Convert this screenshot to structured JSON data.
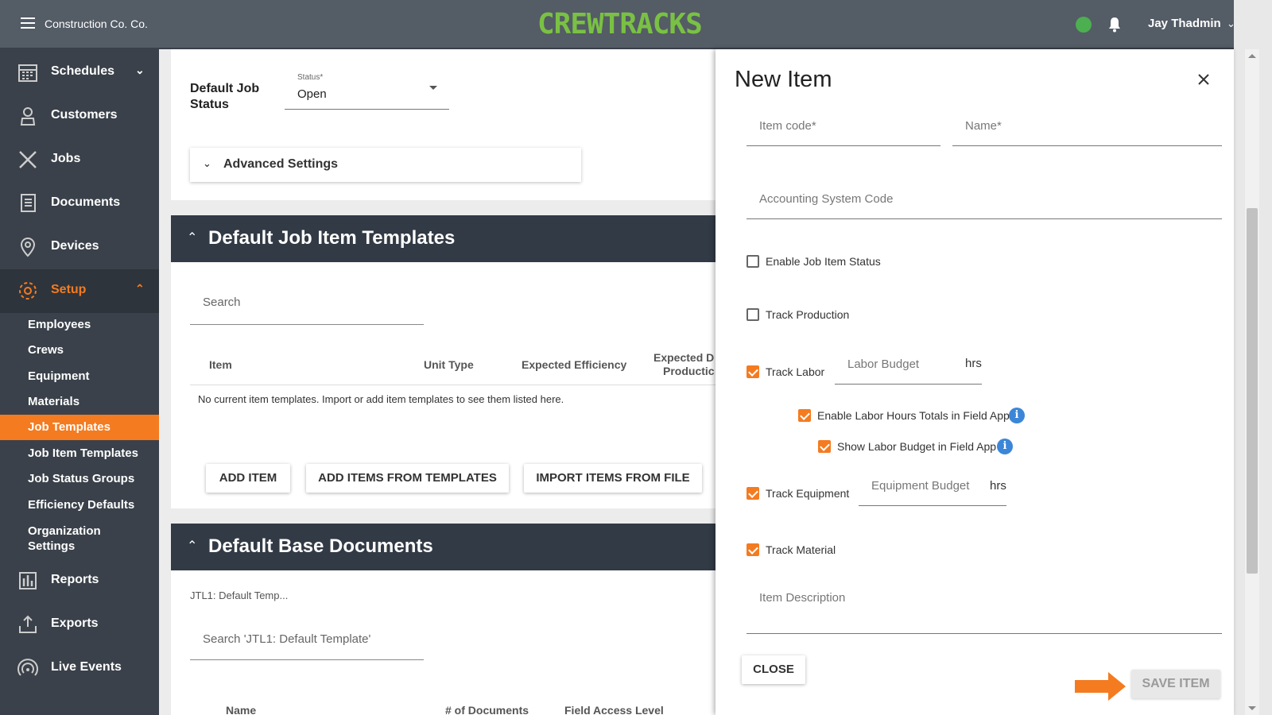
{
  "header": {
    "company": "Construction Co. Co.",
    "logo": "CREWTRACKS",
    "user": "Jay Thadmin",
    "status_color": "#4caf50"
  },
  "sidebar": {
    "items": [
      {
        "label": "Schedules",
        "icon": "calendar-icon"
      },
      {
        "label": "Customers",
        "icon": "customer-icon"
      },
      {
        "label": "Jobs",
        "icon": "tools-icon"
      },
      {
        "label": "Documents",
        "icon": "documents-icon"
      },
      {
        "label": "Devices",
        "icon": "location-pin-icon"
      },
      {
        "label": "Setup",
        "icon": "gear-icon"
      },
      {
        "label": "Reports",
        "icon": "bar-chart-icon"
      },
      {
        "label": "Exports",
        "icon": "export-icon"
      },
      {
        "label": "Live Events",
        "icon": "broadcast-icon"
      }
    ],
    "setup_items": [
      "Employees",
      "Crews",
      "Equipment",
      "Materials",
      "Job Templates",
      "Job Item Templates",
      "Job Status Groups",
      "Efficiency Defaults",
      "Organization Settings"
    ],
    "active_color": "#f47b20"
  },
  "main": {
    "default_job_status_label": "Default Job Status",
    "status_field_label": "Status*",
    "status_value": "Open",
    "advanced_settings": "Advanced Settings",
    "item_templates": {
      "title": "Default Job Item Templates",
      "search_placeholder": "Search",
      "columns": [
        "Item",
        "Unit Type",
        "Expected Efficiency",
        "Expected D",
        "Productic"
      ],
      "empty_message": "No current item templates. Import or add item templates to see them listed here.",
      "buttons": [
        "ADD ITEM",
        "ADD ITEMS FROM TEMPLATES",
        "IMPORT ITEMS FROM FILE"
      ]
    },
    "base_documents": {
      "title": "Default Base Documents",
      "subtitle": "JTL1: Default Temp...",
      "search_placeholder": "Search 'JTL1: Default Template'",
      "columns": [
        "Name",
        "# of Documents",
        "Field Access Level"
      ]
    }
  },
  "panel": {
    "title": "New Item",
    "item_code_placeholder": "Item code*",
    "name_placeholder": "Name*",
    "accounting_code_placeholder": "Accounting System Code",
    "enable_job_item_status": {
      "label": "Enable Job Item Status",
      "checked": false
    },
    "track_production": {
      "label": "Track Production",
      "checked": false
    },
    "track_labor": {
      "label": "Track Labor",
      "checked": true
    },
    "labor_budget_placeholder": "Labor Budget",
    "labor_unit": "hrs",
    "enable_labor_hours": {
      "label": "Enable Labor Hours Totals in Field App",
      "checked": true
    },
    "show_labor_budget": {
      "label": "Show Labor Budget in Field App",
      "checked": true
    },
    "track_equipment": {
      "label": "Track Equipment",
      "checked": true
    },
    "equipment_budget_placeholder": "Equipment Budget",
    "equipment_unit": "hrs",
    "track_material": {
      "label": "Track Material",
      "checked": true
    },
    "item_description_placeholder": "Item Description",
    "close_label": "CLOSE",
    "save_label": "SAVE ITEM",
    "arrow_color": "#f47b20"
  }
}
